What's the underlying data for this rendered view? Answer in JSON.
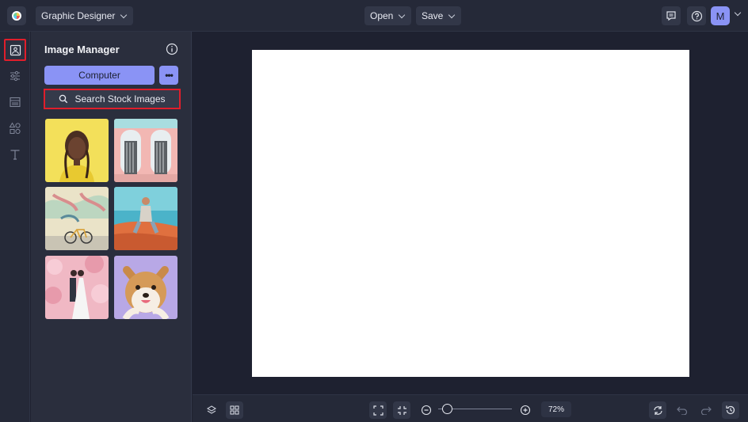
{
  "header": {
    "project_menu": "Graphic Designer",
    "open_label": "Open",
    "save_label": "Save",
    "avatar_initial": "M",
    "icons": [
      "app-logo",
      "comment-icon",
      "help-icon",
      "chevron-down-icon"
    ]
  },
  "rail": {
    "items": [
      "image-manager-icon",
      "adjustments-icon",
      "layout-icon",
      "elements-icon",
      "text-icon"
    ],
    "active": "image-manager-icon"
  },
  "panel": {
    "title": "Image Manager",
    "computer_label": "Computer",
    "more_label": "•••",
    "search_label": "Search Stock Images",
    "images": [
      "portrait-woman-yellow",
      "pink-building-doors",
      "mural-bicycle",
      "man-sitting-desert",
      "couple-cherry-blossoms",
      "shiba-dog"
    ]
  },
  "bottom": {
    "zoom": "72%",
    "zoom_fraction": 0.12
  },
  "colors": {
    "accent": "#8a93f5",
    "highlight": "#e01e2b",
    "bg": "#1f2230"
  }
}
